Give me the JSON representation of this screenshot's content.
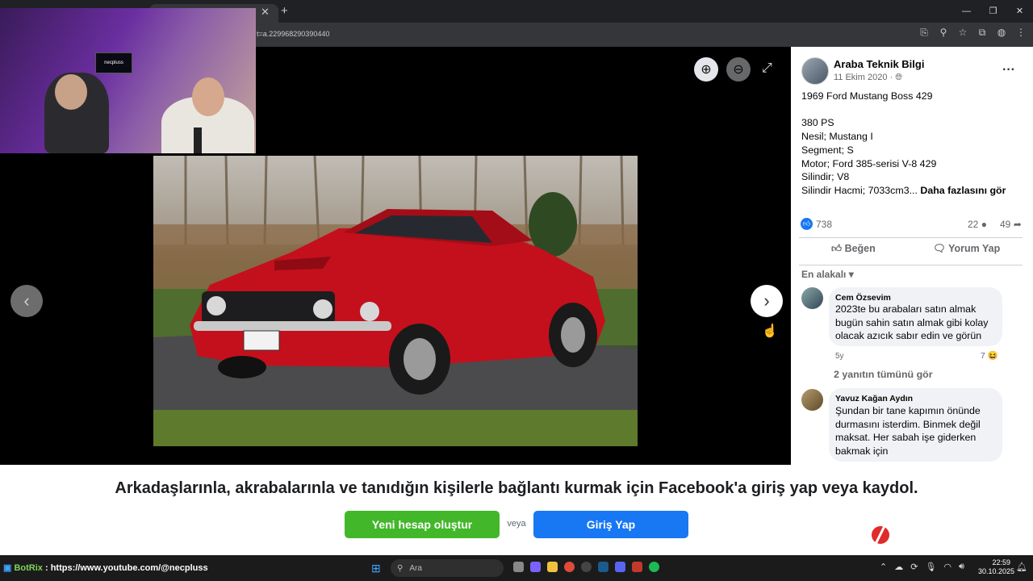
{
  "browser": {
    "url_visible": "t=a.229968290390440",
    "new_tab_label": "+",
    "close_tab": "✕",
    "window_controls": [
      "—",
      "❐",
      "✕"
    ],
    "toolbar_icons": [
      "cast-icon",
      "zoom-icon",
      "star-icon",
      "extensions-icon",
      "profile-icon",
      "menu-icon"
    ]
  },
  "webcam": {
    "sign_text": "necpluss"
  },
  "viewer": {
    "zoom_in_icon": "⊕",
    "zoom_out_icon": "⊖",
    "fullscreen_icon": "⤢",
    "prev_icon": "‹",
    "next_icon": "›"
  },
  "post": {
    "page_name": "Araba Teknik Bilgi",
    "date": "11 Ekim 2020 · ",
    "audience_icon": "globe-icon",
    "more_label": "···",
    "lines": [
      "1969 Ford Mustang Boss 429",
      "",
      "380 PS",
      "Nesil; Mustang I",
      "Segment; S",
      "Motor; Ford 385-serisi V-8 429",
      "Silindir; V8"
    ],
    "last_line": "Silindir Hacmi; 7033cm3... ",
    "see_more": "Daha fazlasını gör",
    "like_count": "738",
    "comment_count": "22",
    "share_count": "49",
    "like_label": "Beğen",
    "comment_label": "Yorum Yap",
    "sort_label": "En alakalı"
  },
  "comments": [
    {
      "author": "Cem Özsevim",
      "text": "2023te bu arabaları satın almak bugün sahin satın almak gibi kolay olacak azıcık sabır edin ve görün",
      "time": "5y",
      "reactions": "7",
      "replies": "2 yanıtın tümünü gör"
    },
    {
      "author": "Yavuz Kağan Aydın",
      "text": "Şundan bir tane kapımın önünde durmasını isterdim. Binmek değil maksat. Her sabah işe giderken bakmak için"
    }
  ],
  "banner": {
    "text": "Arkadaşlarınla, akrabalarınla ve tanıdığın kişilerle bağlantı kurmak için Facebook'a giriş yap veya kaydol.",
    "signup": "Yeni hesap oluştur",
    "or": "veya",
    "login": "Giriş Yap"
  },
  "taskbar": {
    "botrix_name": "BotRix",
    "botrix_msg": " : https://www.youtube.com/@necpluss",
    "search_placeholder": "Ara",
    "time": "22:59",
    "date": "30.10.2025"
  },
  "colors": {
    "facebook_blue": "#1877f2",
    "signup_green": "#42b72a"
  }
}
